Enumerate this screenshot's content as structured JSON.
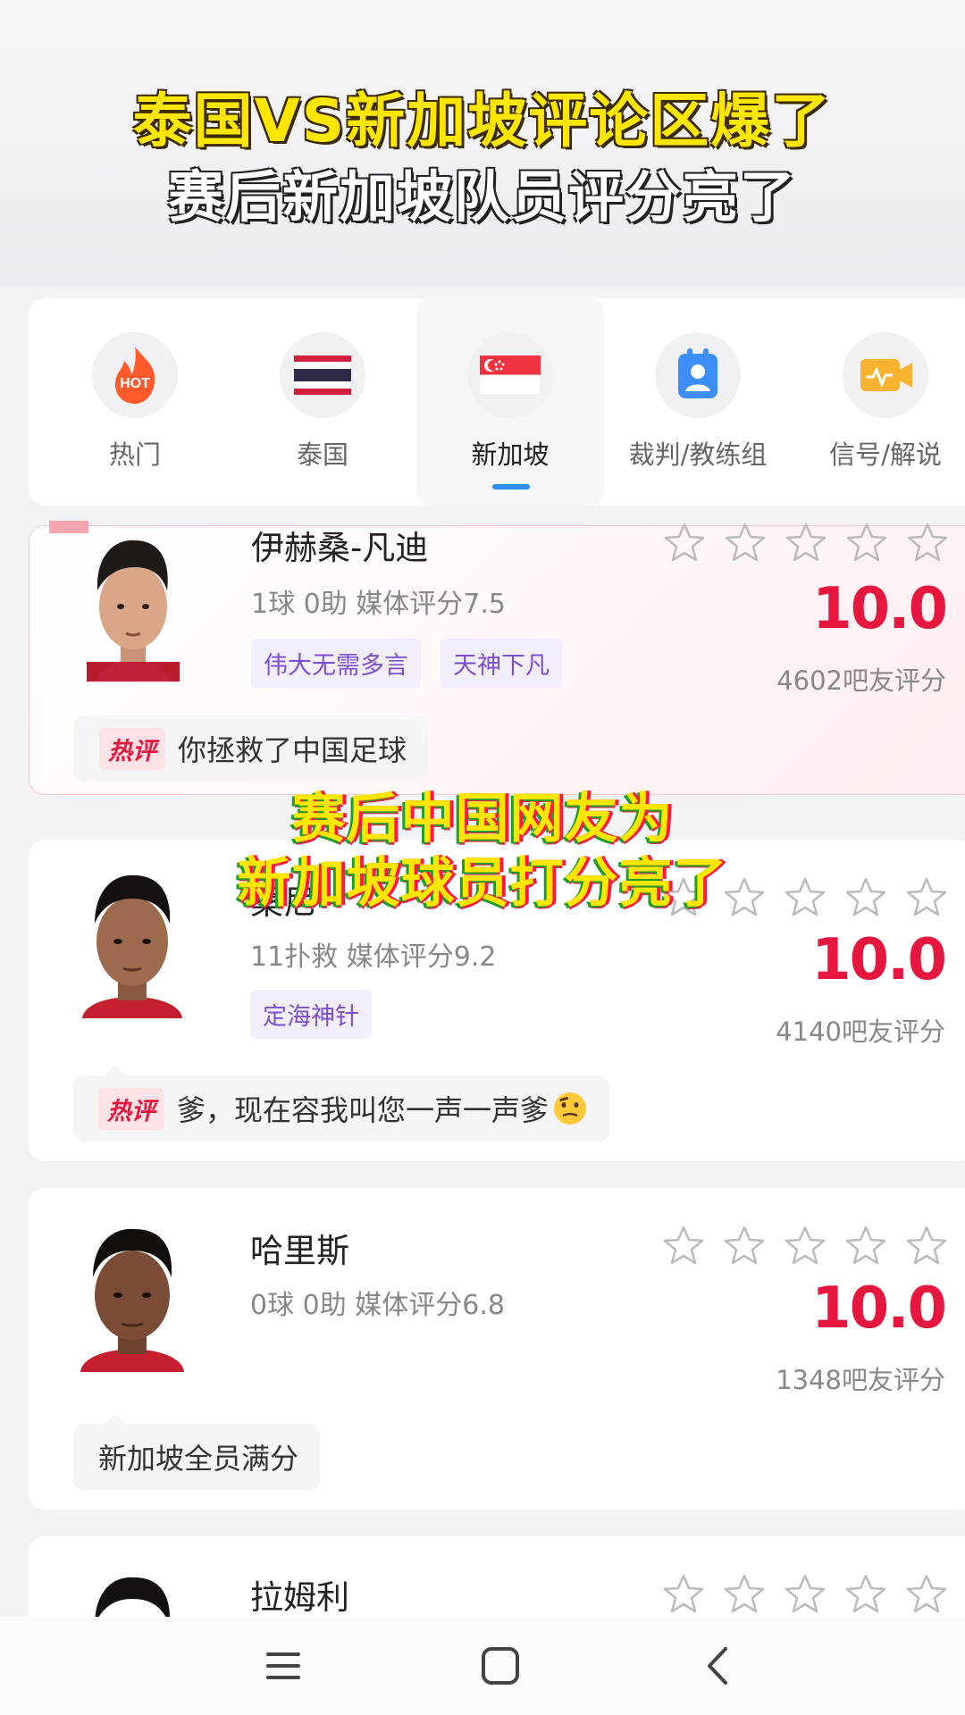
{
  "caption": {
    "line1": "泰国VS新加坡评论区爆了",
    "line2": "赛后新加坡队员评分亮了"
  },
  "tabs": [
    {
      "label": "热门",
      "icon": "hot-icon",
      "icon_text": "HOT",
      "active": false
    },
    {
      "label": "泰国",
      "icon": "thailand-flag-icon",
      "active": false
    },
    {
      "label": "新加坡",
      "icon": "singapore-flag-icon",
      "active": true
    },
    {
      "label": "裁判/教练组",
      "icon": "referee-badge-icon",
      "active": false
    },
    {
      "label": "信号/解说",
      "icon": "camera-signal-icon",
      "active": false
    }
  ],
  "players": [
    {
      "name": "伊赫桑-凡迪",
      "stats": "1球 0助  媒体评分7.5",
      "tags": [
        "伟大无需多言",
        "天神下凡"
      ],
      "score": "10.0",
      "rating_count": "4602吧友评分",
      "comment_badge": "热评",
      "comment": "你拯救了中国足球"
    },
    {
      "name": "桑尼",
      "stats": "11扑救  媒体评分9.2",
      "tags": [
        "定海神针"
      ],
      "score": "10.0",
      "rating_count": "4140吧友评分",
      "comment_badge": "热评",
      "comment": "爹，现在容我叫您一声一声爹"
    },
    {
      "name": "哈里斯",
      "stats": "0球 0助  媒体评分6.8",
      "tags": [],
      "score": "10.0",
      "rating_count": "1348吧友评分",
      "comment": "新加坡全员满分"
    },
    {
      "name": "拉姆利"
    }
  ],
  "overlay": {
    "line1": "赛后中国网友为",
    "line2": "新加坡球员打分亮了"
  },
  "colors": {
    "score_red": "#e5173f",
    "tag_purple": "#7a4fd0",
    "tab_accent": "#2a8ef5",
    "caption_yellow": "#ffe600"
  }
}
